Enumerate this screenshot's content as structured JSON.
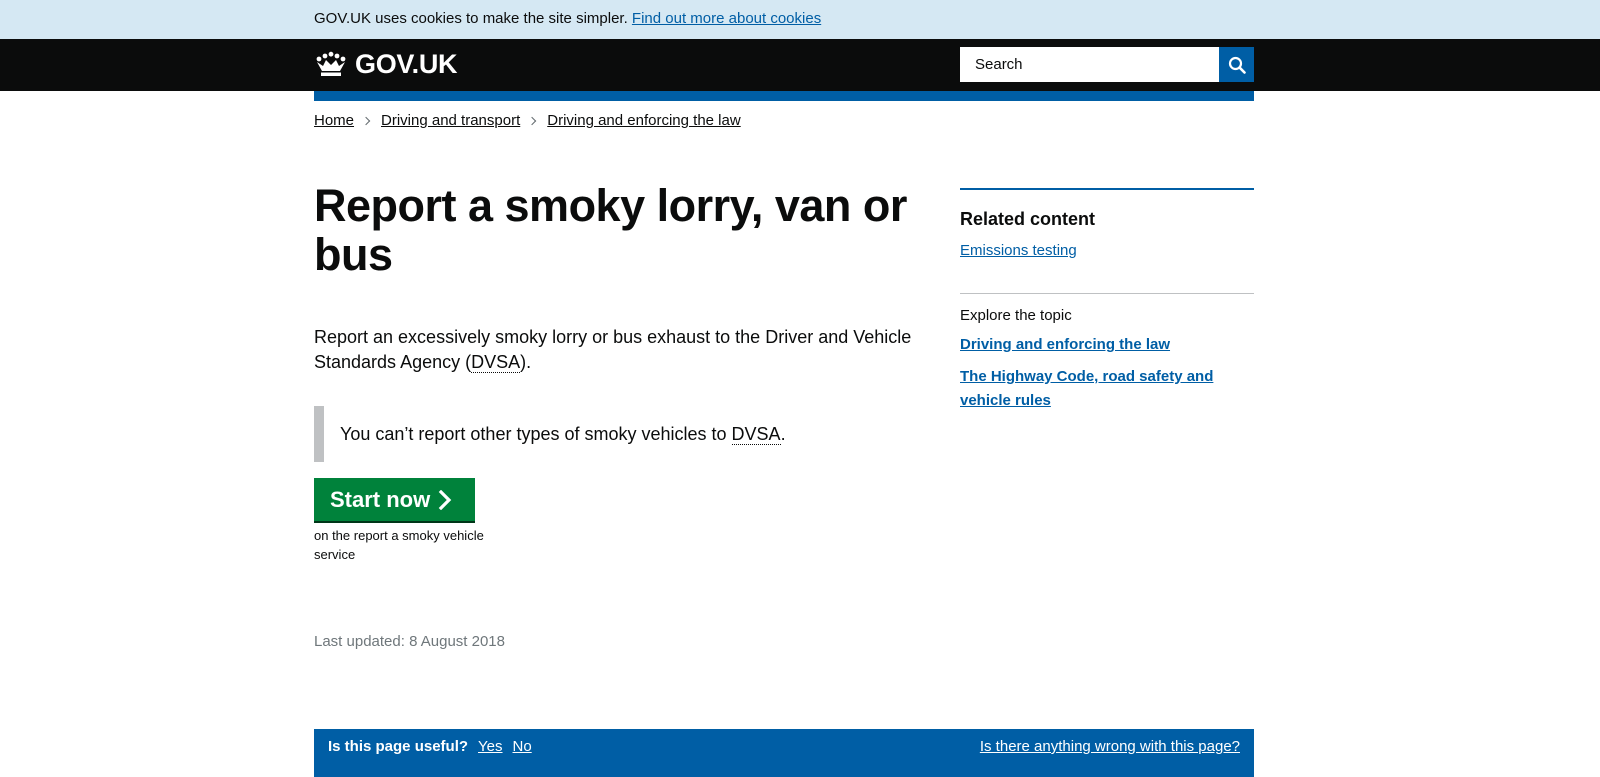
{
  "cookie_banner": {
    "text": "GOV.UK uses cookies to make the site simpler.",
    "link": "Find out more about cookies"
  },
  "header": {
    "logo_text": "GOV.UK",
    "search_placeholder": "Search"
  },
  "breadcrumbs": [
    "Home",
    "Driving and transport",
    "Driving and enforcing the law"
  ],
  "main": {
    "title": "Report a smoky lorry, van or bus",
    "lead_before": "Report an excessively smoky lorry or bus exhaust to the Driver and Vehicle Standards Agency (",
    "lead_abbr": "DVSA",
    "lead_after": ").",
    "inset_before": "You can’t report other types of smoky vehicles to ",
    "inset_abbr": "DVSA",
    "inset_after": ".",
    "start_button": "Start now",
    "start_caption": "on the report a smoky vehicle service",
    "last_updated": "Last updated: 8 August 2018"
  },
  "sidebar": {
    "related_title": "Related content",
    "related_links": [
      "Emissions testing"
    ],
    "explore_label": "Explore the topic",
    "explore_links": [
      "Driving and enforcing the law",
      "The Highway Code, road safety and vehicle rules"
    ]
  },
  "feedback": {
    "question": "Is this page useful?",
    "yes": "Yes",
    "no": "No",
    "report": "Is there anything wrong with this page?"
  },
  "colors": {
    "brand_blue": "#005ea5",
    "header_black": "#0b0c0c",
    "start_green": "#00823b",
    "cookie_bg": "#d5e8f3"
  },
  "icons": {
    "logo": "crown-icon",
    "search": "search-icon",
    "start": "chevron-right-icon",
    "breadcrumb_separator": "chevron-right-icon"
  }
}
